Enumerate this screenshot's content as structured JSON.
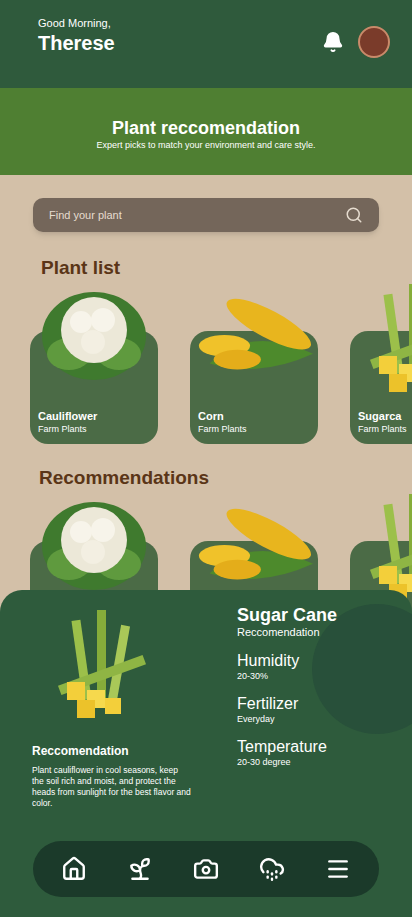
{
  "header": {
    "greeting": "Good Morning,",
    "name": "Therese"
  },
  "banner": {
    "title": "Plant reccomendation",
    "subtitle": "Expert picks to match your environment and care style."
  },
  "search": {
    "placeholder": "Find your plant"
  },
  "plant_list": {
    "title": "Plant list",
    "items": [
      {
        "name": "Cauliflower",
        "category": "Farm Plants"
      },
      {
        "name": "Corn",
        "category": "Farm Plants"
      },
      {
        "name": "Sugarca",
        "category": "Farm Plants"
      }
    ]
  },
  "recommendations": {
    "title": "Recommendations",
    "items": [
      {},
      {},
      {}
    ]
  },
  "detail": {
    "title": "Sugar Cane",
    "subtitle": "Reccomendation",
    "stats": [
      {
        "label": "Humidity",
        "value": "20-30%"
      },
      {
        "label": "Fertilizer",
        "value": "Everyday"
      },
      {
        "label": "Temperature",
        "value": "20-30 degree"
      }
    ],
    "note_title": "Reccomendation",
    "note": "Plant cauliflower in cool seasons, keep the soil rich and moist, and protect the heads from sunlight for  the best flavor and color."
  }
}
